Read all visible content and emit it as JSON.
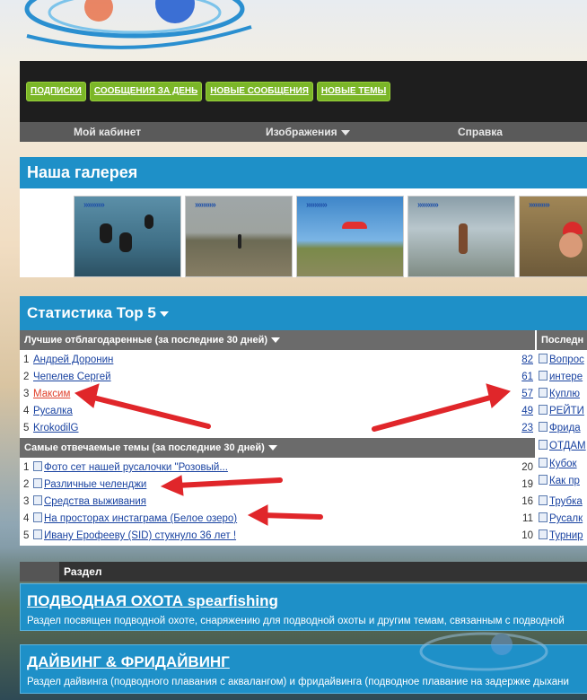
{
  "top_buttons": [
    "ПОДПИСКИ",
    "СООБЩЕНИЯ ЗА ДЕНЬ",
    "НОВЫЕ СООБЩЕНИЯ",
    "НОВЫЕ ТЕМЫ"
  ],
  "nav": {
    "cabinet": "Мой кабинет",
    "images": "Изображения",
    "help": "Справка"
  },
  "gallery": {
    "title": "Наша галерея",
    "thumb_arrows": "»»»»»"
  },
  "stats": {
    "title": "Статистика Top 5",
    "thanked_header": "Лучшие отблагодаренные (за последние 30 дней)",
    "latest_header": "Последн",
    "thanked": [
      {
        "n": "1",
        "name": "Андрей Доронин",
        "count": "82"
      },
      {
        "n": "2",
        "name": "Чепелев Сергей",
        "count": "61"
      },
      {
        "n": "3",
        "name": "Максим",
        "count": "57"
      },
      {
        "n": "4",
        "name": "Русалка",
        "count": "49"
      },
      {
        "n": "5",
        "name": "KrokodilG",
        "count": "23"
      }
    ],
    "replied_header": "Самые отвечаемые темы (за последние 30 дней)",
    "replied": [
      {
        "n": "1",
        "name": "Фото сет нашей русалочки \"Розовый...",
        "count": "20"
      },
      {
        "n": "2",
        "name": "Различные челенджи",
        "count": "19"
      },
      {
        "n": "3",
        "name": "Средства выживания",
        "count": "16"
      },
      {
        "n": "4",
        "name": "На просторах инстаграма (Белое озеро)",
        "count": "11"
      },
      {
        "n": "5",
        "name": "Ивану Ерофееву (SID) стукнуло 36 лет !",
        "count": "10"
      }
    ],
    "latest": [
      "Вопрос",
      "интере",
      "Куплю",
      "РЕЙТИ",
      "Фрида",
      "ОТДАМ",
      "Кубок",
      "Как пр",
      "Трубка",
      "Русалк",
      "Турнир"
    ]
  },
  "section": {
    "label": "Раздел"
  },
  "forums": [
    {
      "title": "ПОДВОДНАЯ ОХОТА spearfishing",
      "desc": "Раздел посвящен подводной охоте, снаряжению для подводной охоты и другим темам, связанным с подводной"
    },
    {
      "title": "ДАЙВИНГ & ФРИДАЙВИНГ",
      "desc": "Раздел дайвинга (подводного плавания с аквалангом) и фридайвинга (подводное плавание на задержке дыхани"
    }
  ],
  "colors": {
    "accent_blue": "#1e90c8",
    "button_green": "#7bb628",
    "annotation_red": "#e0262a"
  }
}
